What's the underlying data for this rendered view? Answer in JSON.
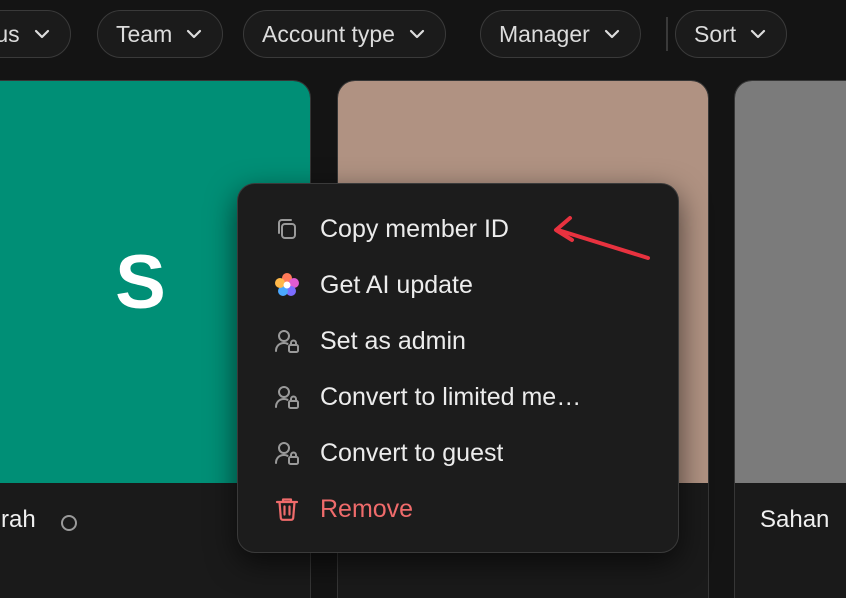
{
  "filters": [
    {
      "label": "Status",
      "visible_text": "tus"
    },
    {
      "label": "Team"
    },
    {
      "label": "Account type"
    },
    {
      "label": "Manager"
    },
    {
      "label": "Sort"
    }
  ],
  "cards": [
    {
      "cover_color": "#008f76",
      "initial": "S",
      "name_visible": "rah"
    },
    {
      "cover_color": "#b09282",
      "name_visible": ""
    },
    {
      "cover_color": "#7b7b7b",
      "name_visible": "Sahan"
    }
  ],
  "context_menu": {
    "items": [
      {
        "label": "Copy member ID",
        "icon": "copy-icon"
      },
      {
        "label": "Get AI update",
        "icon": "ai-sparkle-icon"
      },
      {
        "label": "Set as admin",
        "icon": "user-lock-icon"
      },
      {
        "label": "Convert to limited me…",
        "icon": "user-lock-icon"
      },
      {
        "label": "Convert to guest",
        "icon": "user-lock-icon"
      },
      {
        "label": "Remove",
        "icon": "trash-icon",
        "color": "#ef6b6b"
      }
    ]
  },
  "annotation": {
    "arrow_color": "#e8323f"
  }
}
